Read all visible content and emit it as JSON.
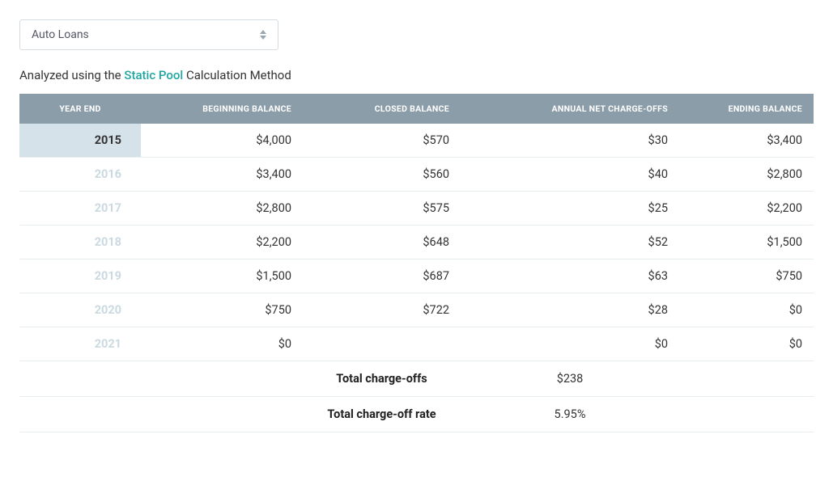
{
  "dropdown": {
    "selected": "Auto Loans"
  },
  "analyzed": {
    "prefix": "Analyzed using the ",
    "link": "Static Pool",
    "suffix": " Calculation Method"
  },
  "table": {
    "headers": {
      "year": "YEAR END",
      "beginning": "BEGINNING BALANCE",
      "closed": "CLOSED BALANCE",
      "chargeoffs": "ANNUAL NET CHARGE-OFFS",
      "ending": "ENDING BALANCE"
    },
    "rows": [
      {
        "year": "2015",
        "beginning": "$4,000",
        "closed": "$570",
        "chargeoffs": "$30",
        "ending": "$3,400",
        "selected": true
      },
      {
        "year": "2016",
        "beginning": "$3,400",
        "closed": "$560",
        "chargeoffs": "$40",
        "ending": "$2,800",
        "selected": false
      },
      {
        "year": "2017",
        "beginning": "$2,800",
        "closed": "$575",
        "chargeoffs": "$25",
        "ending": "$2,200",
        "selected": false
      },
      {
        "year": "2018",
        "beginning": "$2,200",
        "closed": "$648",
        "chargeoffs": "$52",
        "ending": "$1,500",
        "selected": false
      },
      {
        "year": "2019",
        "beginning": "$1,500",
        "closed": "$687",
        "chargeoffs": "$63",
        "ending": "$750",
        "selected": false
      },
      {
        "year": "2020",
        "beginning": "$750",
        "closed": "$722",
        "chargeoffs": "$28",
        "ending": "$0",
        "selected": false
      },
      {
        "year": "2021",
        "beginning": "$0",
        "closed": "",
        "chargeoffs": "$0",
        "ending": "$0",
        "selected": false
      }
    ],
    "summary": [
      {
        "label": "Total charge-offs",
        "value": "$238"
      },
      {
        "label": "Total charge-off rate",
        "value": "5.95%"
      }
    ]
  }
}
